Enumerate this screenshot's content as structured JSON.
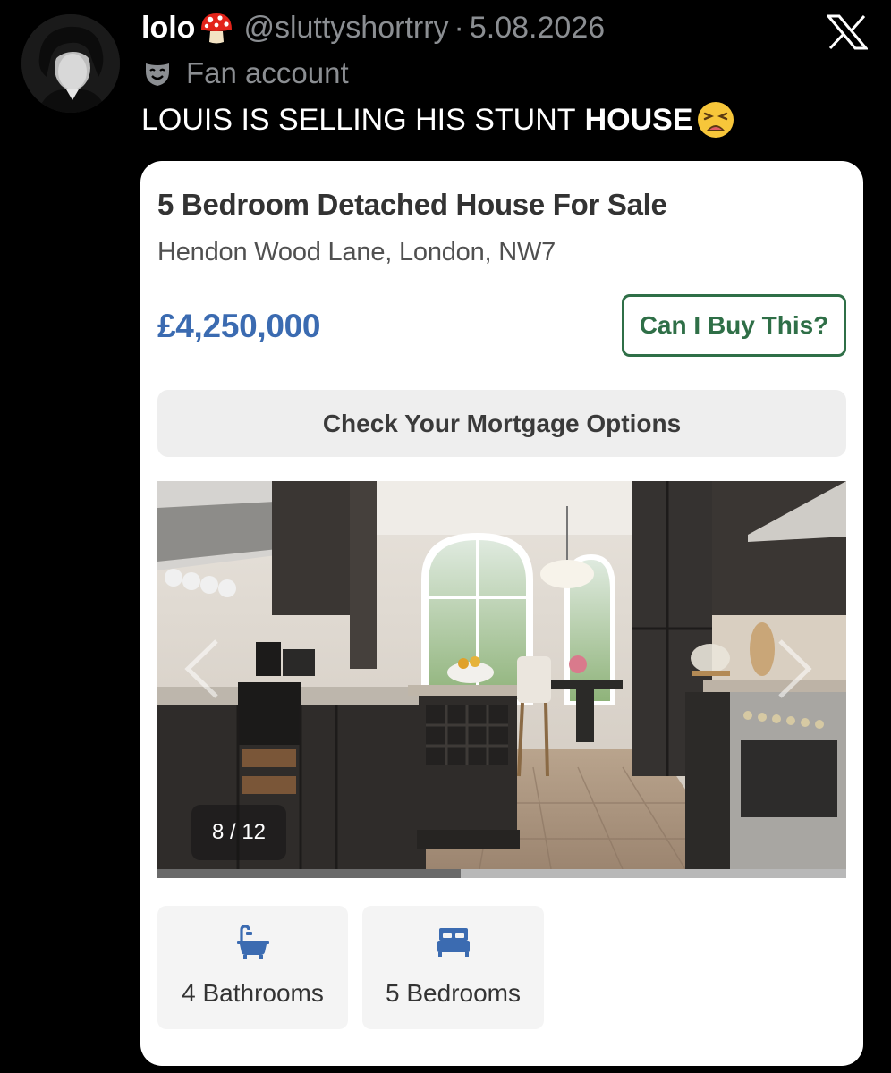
{
  "tweet": {
    "display_name": "lolo",
    "handle": "@sluttyshortrry",
    "separator": "·",
    "date": "5.08.2026",
    "account_label": "Fan account",
    "text_prefix": "LOUIS IS SELLING HIS STUNT",
    "text_bold": "HOUSE",
    "icons": [
      "mushroom-emoji",
      "mask-icon",
      "weary-face-emoji",
      "x-logo"
    ]
  },
  "listing": {
    "title": "5 Bedroom Detached House For Sale",
    "address": "Hendon Wood Lane, London, NW7",
    "price": "£4,250,000",
    "buy_button": "Can I Buy This?",
    "mortgage_button": "Check Your Mortgage Options",
    "gallery": {
      "counter": "8 / 12",
      "current_image": 8,
      "total_images": 12,
      "scroll_progress": 0.44
    },
    "features": [
      {
        "icon": "bathtub-icon",
        "label": "4 Bathrooms"
      },
      {
        "icon": "bed-icon",
        "label": "5 Bedrooms"
      }
    ]
  },
  "colors": {
    "background": "#000000",
    "muted_text": "#8b8e92",
    "price_blue": "#3b6bb1",
    "button_green": "#2f6f47",
    "icon_blue": "#3b6bb1"
  }
}
